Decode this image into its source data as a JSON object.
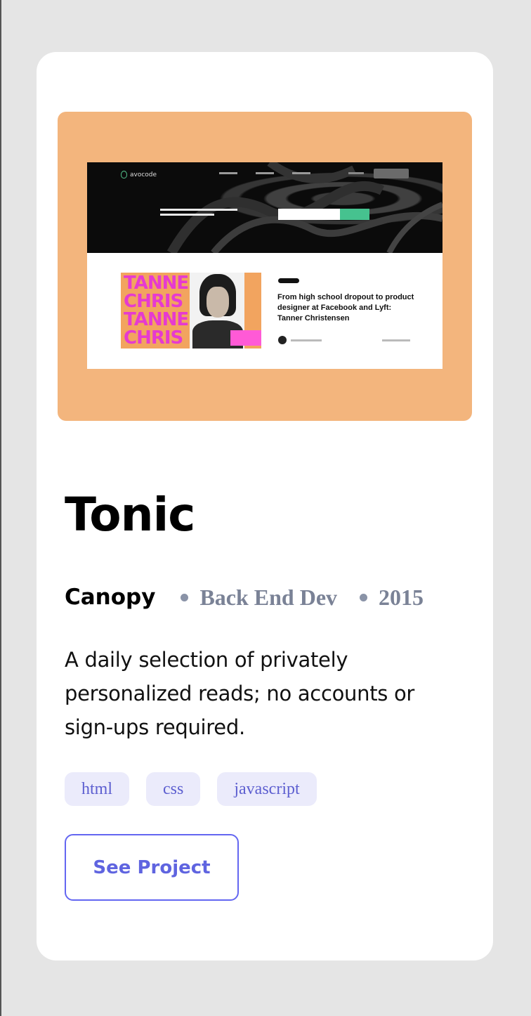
{
  "card": {
    "title": "Tonic",
    "company": "Canopy",
    "role": "Back End Dev",
    "year": "2015",
    "description": "A daily selection of privately personalized reads; no accounts or sign-ups required.",
    "tags": [
      "html",
      "css",
      "javascript"
    ],
    "cta_label": "See Project",
    "preview": {
      "background": "#f3b57d",
      "logo_text": "avocode",
      "art_lines": [
        "TANNE",
        "CHRIS",
        "TANNE",
        "CHRIS"
      ],
      "article_title": "From high school dropout to product designer at Facebook and Lyft: Tanner Christensen"
    }
  },
  "colors": {
    "page_bg": "#e5e5e5",
    "card_bg": "#ffffff",
    "accent": "#6366f1",
    "muted": "#7a8296",
    "tag_bg": "#ebebfb"
  }
}
